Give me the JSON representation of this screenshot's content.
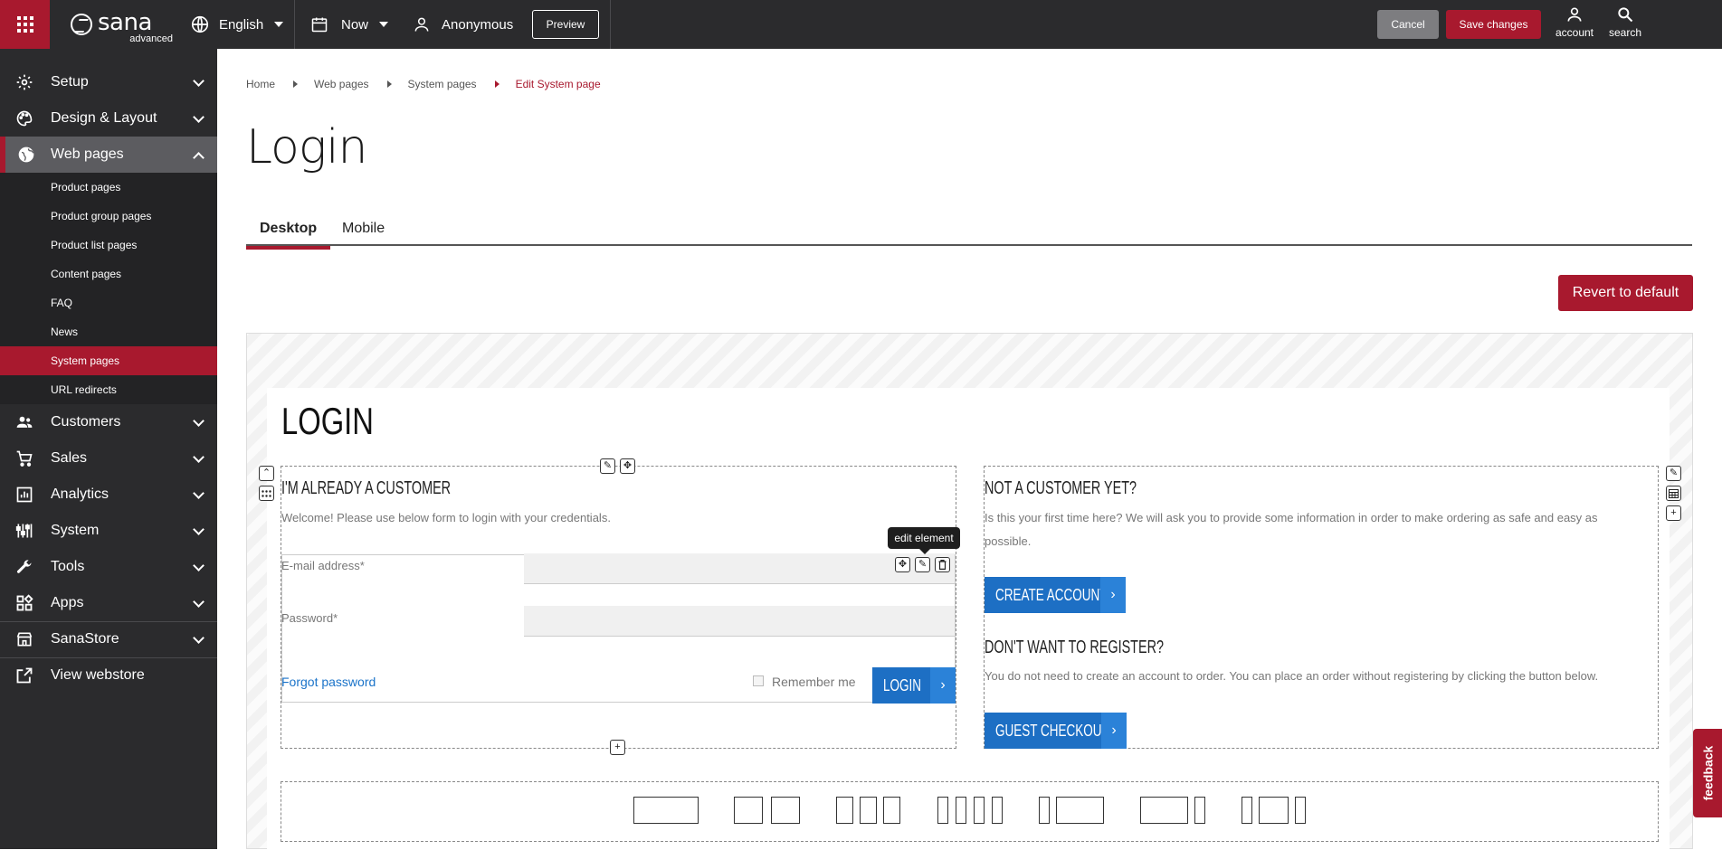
{
  "topbar": {
    "logo_text": "sana",
    "logo_sub": "advanced",
    "language": "English",
    "date": "Now",
    "user": "Anonymous",
    "preview_label": "Preview",
    "cancel_label": "Cancel",
    "save_label": "Save changes",
    "account_label": "account",
    "search_label": "search",
    "accent_color": "#a8192e"
  },
  "sidebar": {
    "items": [
      {
        "label": "Setup",
        "icon": "gear-icon"
      },
      {
        "label": "Design & Layout",
        "icon": "palette-icon"
      },
      {
        "label": "Web pages",
        "icon": "globe-icon"
      },
      {
        "label": "Customers",
        "icon": "people-icon"
      },
      {
        "label": "Sales",
        "icon": "cart-icon"
      },
      {
        "label": "Analytics",
        "icon": "chart-icon"
      },
      {
        "label": "System",
        "icon": "sliders-icon"
      },
      {
        "label": "Tools",
        "icon": "wrench-icon"
      },
      {
        "label": "Apps",
        "icon": "apps-icon"
      },
      {
        "label": "SanaStore",
        "icon": "store-icon"
      },
      {
        "label": "View webstore",
        "icon": "external-link-icon"
      }
    ],
    "subitems": [
      {
        "label": "Product pages"
      },
      {
        "label": "Product group pages"
      },
      {
        "label": "Product list pages"
      },
      {
        "label": "Content pages"
      },
      {
        "label": "FAQ"
      },
      {
        "label": "News"
      },
      {
        "label": "System pages"
      },
      {
        "label": "URL redirects"
      }
    ]
  },
  "breadcrumb": [
    "Home",
    "Web pages",
    "System pages",
    "Edit System page"
  ],
  "page_title": "Login",
  "tabs": [
    {
      "label": "Desktop"
    },
    {
      "label": "Mobile"
    }
  ],
  "revert_label": "Revert to default",
  "preview": {
    "heading": "LOGIN",
    "existing": {
      "title": "I'M ALREADY A CUSTOMER",
      "text": "Welcome! Please use below form to login with your credentials.",
      "email_label": "E-mail address*",
      "password_label": "Password*",
      "forgot_label": "Forgot password",
      "remember_label": "Remember me",
      "login_label": "LOGIN"
    },
    "new": {
      "title": "NOT A CUSTOMER YET?",
      "text": "Is this your first time here? We will ask you to provide some information in order to make ordering as safe and easy as possible.",
      "create_label": "CREATE ACCOUNT",
      "guest_title": "DON'T WANT TO REGISTER?",
      "guest_text": "You do not need to create an account to order. You can place an order without registering by clicking the button below.",
      "guest_label": "GUEST CHECKOUT"
    },
    "tooltip": "edit element"
  },
  "feedback_label": "feedback"
}
